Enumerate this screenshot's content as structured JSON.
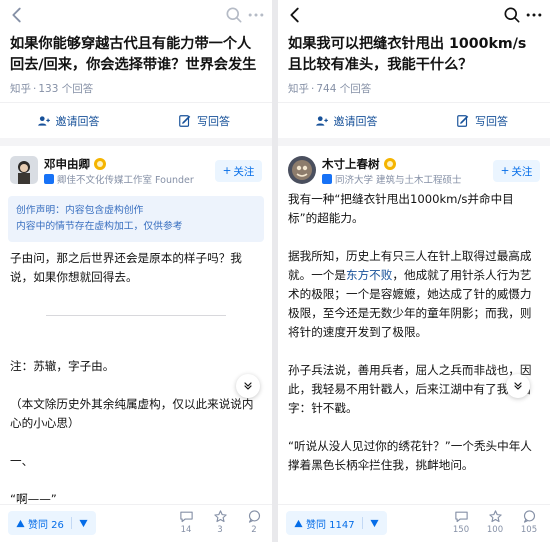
{
  "left": {
    "question": {
      "title": "如果你能够穿越古代且有能力带一个人回去/回来，你会选择带谁？世界会发生什...",
      "source": "知乎",
      "answer_count": "133 个回答"
    },
    "actions": {
      "invite": "邀请回答",
      "write": "写回答"
    },
    "author": {
      "name": "邓申由卿",
      "desc": "卿佳不文化传媒工作室 Founder",
      "follow": "关注"
    },
    "notice": {
      "line1": "创作声明：内容包含虚构创作",
      "line2": "内容中的情节存在虚构加工，仅供参考"
    },
    "body": {
      "p1": "子由问，那之后世界还会是原本的样子吗？我说，如果你想就回得去。",
      "p2": "注：苏辙，字子由。",
      "p3": "（本文除历史外其余纯属虚构，仅以此来说说内心的小心思）",
      "p4": "一、",
      "p5": "“啊——”"
    },
    "footer": {
      "upvote": "赞同 26",
      "comments": "14",
      "favorites": "3",
      "likes": "2"
    }
  },
  "right": {
    "question": {
      "title": "如果我可以把缝衣针甩出 1000km/s 且比较有准头，我能干什么？",
      "source": "知乎",
      "answer_count": "744 个回答"
    },
    "actions": {
      "invite": "邀请回答",
      "write": "写回答"
    },
    "author": {
      "name": "木寸上春树",
      "desc": "同济大学 建筑与土木工程硕士",
      "follow": "关注"
    },
    "body": {
      "p1": "我有一种“把缝衣针甩出1000km/s并命中目标”的超能力。",
      "p2_a": "据我所知，历史上有只三人在针上取得过最高成就。一个是",
      "p2_link": "东方不败",
      "p2_b": "，他成就了用针杀人行为艺术的极限；一个是容嬷嬷，她达成了针的威慑力极限，至今还是无数少年的童年阴影；而我，则将针的速度开发到了极限。",
      "p3": "孙子兵法说，善用兵者，屈人之兵而非战也，因此，我轻易不用针戳人，后来江湖中有了我的名字：针不戳。",
      "p4": "“听说从没人见过你的绣花针？”一个秃头中年人撑着黑色长柄伞拦住我，挑衅地问。"
    },
    "footer": {
      "upvote": "赞同 1147",
      "comments": "150",
      "favorites": "100",
      "likes": "105"
    }
  },
  "colors": {
    "blue": "#056de8",
    "link": "#175199",
    "muted": "#8590a6",
    "notice_bg": "#edf3fc"
  }
}
